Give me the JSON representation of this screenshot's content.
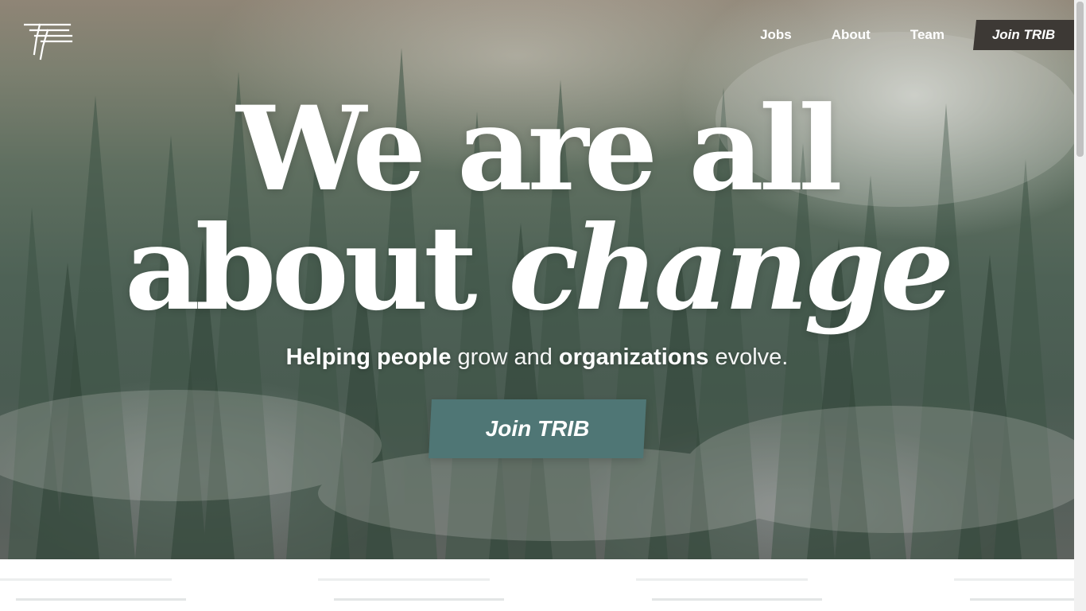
{
  "brand": {
    "logo_icon": "trib-logo-icon"
  },
  "nav": {
    "links": [
      "Jobs",
      "About",
      "Team"
    ],
    "cta_label": "Join TRIB"
  },
  "hero": {
    "headline_line1": "We are all",
    "headline_line2_plain": "about ",
    "headline_line2_emphasis": "change",
    "sub": {
      "part1_bold": "Helping people",
      "part2": " grow and ",
      "part3_bold": "organizations",
      "part4": " evolve."
    },
    "cta_label": "Join TRIB"
  },
  "colors": {
    "nav_cta_bg": "#3d3935",
    "hero_cta_bg": "#4f7675",
    "text": "#ffffff"
  }
}
